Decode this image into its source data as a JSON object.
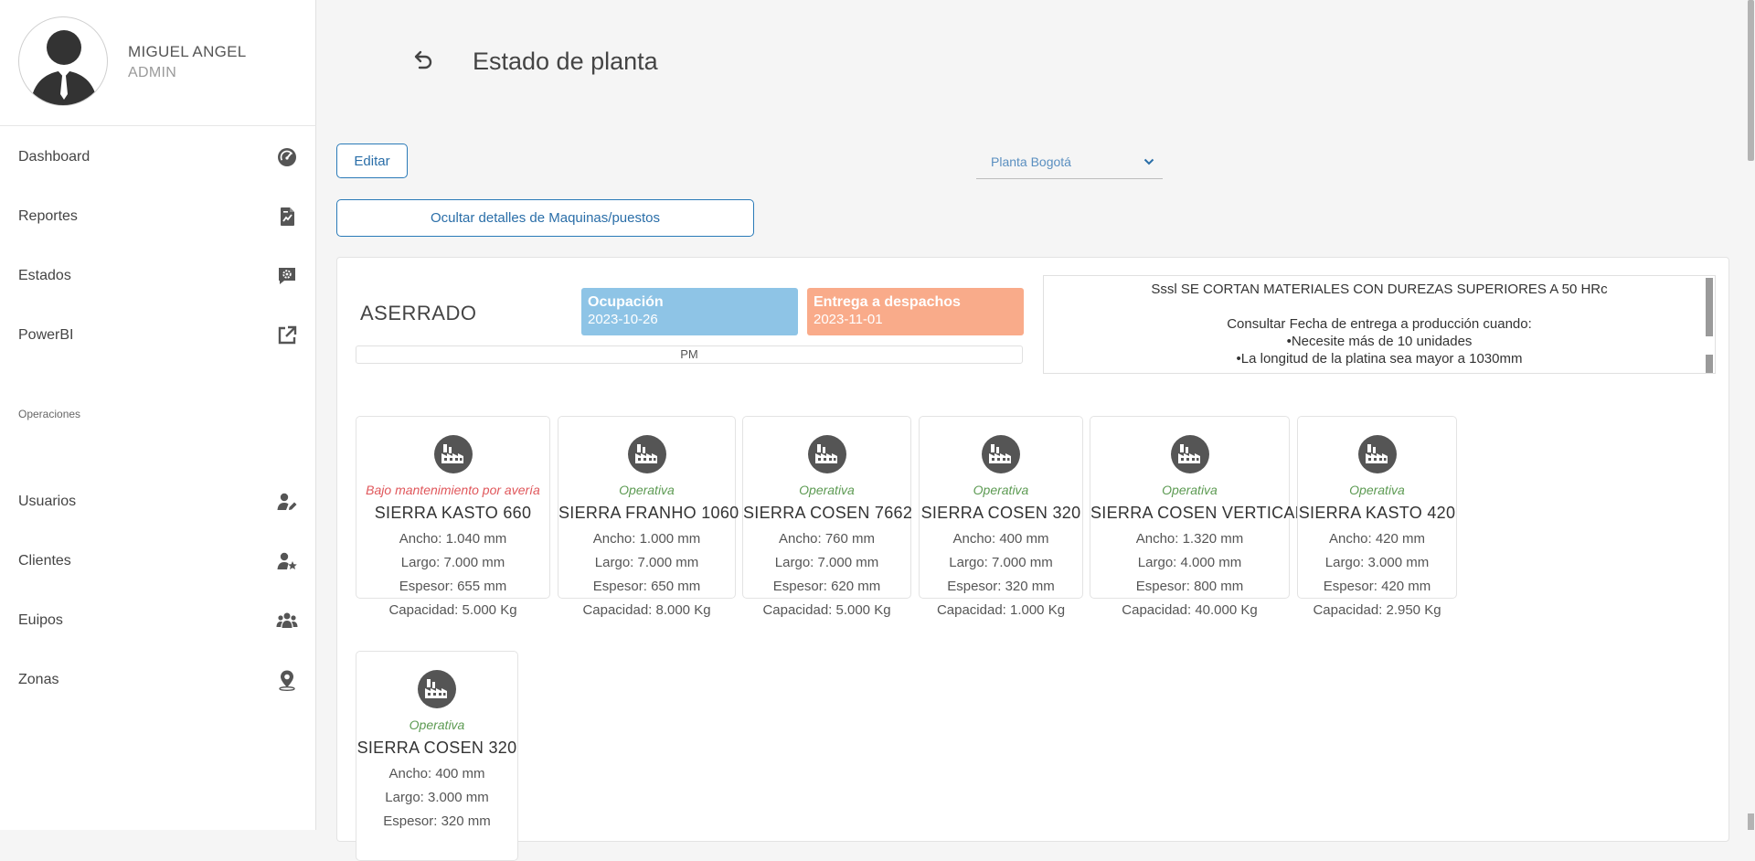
{
  "user": {
    "name": "MIGUEL ANGEL",
    "role": "ADMIN"
  },
  "nav": {
    "main": [
      {
        "label": "Dashboard",
        "icon": "speedometer-icon"
      },
      {
        "label": "Reportes",
        "icon": "report-chart-icon"
      },
      {
        "label": "Estados",
        "icon": "chat-gear-icon"
      },
      {
        "label": "PowerBI",
        "icon": "external-link-icon"
      }
    ],
    "section_title": "Operaciones",
    "operations": [
      {
        "label": "Usuarios",
        "icon": "user-edit-icon"
      },
      {
        "label": "Clientes",
        "icon": "user-star-icon"
      },
      {
        "label": "Euipos",
        "icon": "people-group-icon"
      },
      {
        "label": "Zonas",
        "icon": "map-pin-icon"
      }
    ]
  },
  "header": {
    "title": "Estado de planta"
  },
  "toolbar": {
    "edit_label": "Editar",
    "plant_selected": "Planta Bogotá",
    "toggle_details_label": "Ocultar detalles de Maquinas/puestos"
  },
  "area": {
    "title": "ASERRADO",
    "occupation": {
      "label": "Ocupación",
      "date": "2023-10-26"
    },
    "delivery": {
      "label": "Entrega a despachos",
      "date": "2023-11-01"
    },
    "shift": "PM",
    "notes": [
      "Sssl SE CORTAN MATERIALES CON DUREZAS SUPERIORES A 50 HRc",
      "",
      "Consultar Fecha de entrega a producción cuando:",
      "•Necesite más de 10 unidades",
      "•La longitud de la platina sea mayor a 1030mm"
    ]
  },
  "machines": [
    {
      "status": "Bajo mantenimiento por avería",
      "status_type": "fault",
      "name": "SIERRA KASTO 660",
      "ancho": "Ancho: 1.040 mm",
      "largo": "Largo: 7.000 mm",
      "espesor": "Espesor: 655 mm",
      "capacidad": "Capacidad: 5.000 Kg"
    },
    {
      "status": "Operativa",
      "status_type": "ok",
      "name": "SIERRA FRANHO 1060",
      "ancho": "Ancho: 1.000 mm",
      "largo": "Largo: 7.000 mm",
      "espesor": "Espesor: 650 mm",
      "capacidad": "Capacidad: 8.000 Kg"
    },
    {
      "status": "Operativa",
      "status_type": "ok",
      "name": "SIERRA COSEN 7662",
      "ancho": "Ancho: 760 mm",
      "largo": "Largo: 7.000 mm",
      "espesor": "Espesor: 620 mm",
      "capacidad": "Capacidad: 5.000 Kg"
    },
    {
      "status": "Operativa",
      "status_type": "ok",
      "name": "SIERRA COSEN 320",
      "ancho": "Ancho: 400 mm",
      "largo": "Largo: 7.000 mm",
      "espesor": "Espesor: 320 mm",
      "capacidad": "Capacidad: 1.000 Kg"
    },
    {
      "status": "Operativa",
      "status_type": "ok",
      "name": "SIERRA COSEN VERTICAL",
      "ancho": "Ancho: 1.320 mm",
      "largo": "Largo: 4.000 mm",
      "espesor": "Espesor: 800 mm",
      "capacidad": "Capacidad: 40.000 Kg"
    },
    {
      "status": "Operativa",
      "status_type": "ok",
      "name": "SIERRA KASTO 420",
      "ancho": "Ancho: 420 mm",
      "largo": "Largo: 3.000 mm",
      "espesor": "Espesor: 420 mm",
      "capacidad": "Capacidad: 2.950 Kg"
    },
    {
      "status": "Operativa",
      "status_type": "ok",
      "name": "SIERRA COSEN 320",
      "ancho": "Ancho: 400 mm",
      "largo": "Largo: 3.000 mm",
      "espesor": "Espesor: 320 mm",
      "capacidad": ""
    }
  ],
  "colors": {
    "accent": "#2a7ab8",
    "occupation": "#8ec4e6",
    "delivery": "#f9ab8a",
    "status_ok": "#5c9a52",
    "status_fault": "#e0575b"
  }
}
